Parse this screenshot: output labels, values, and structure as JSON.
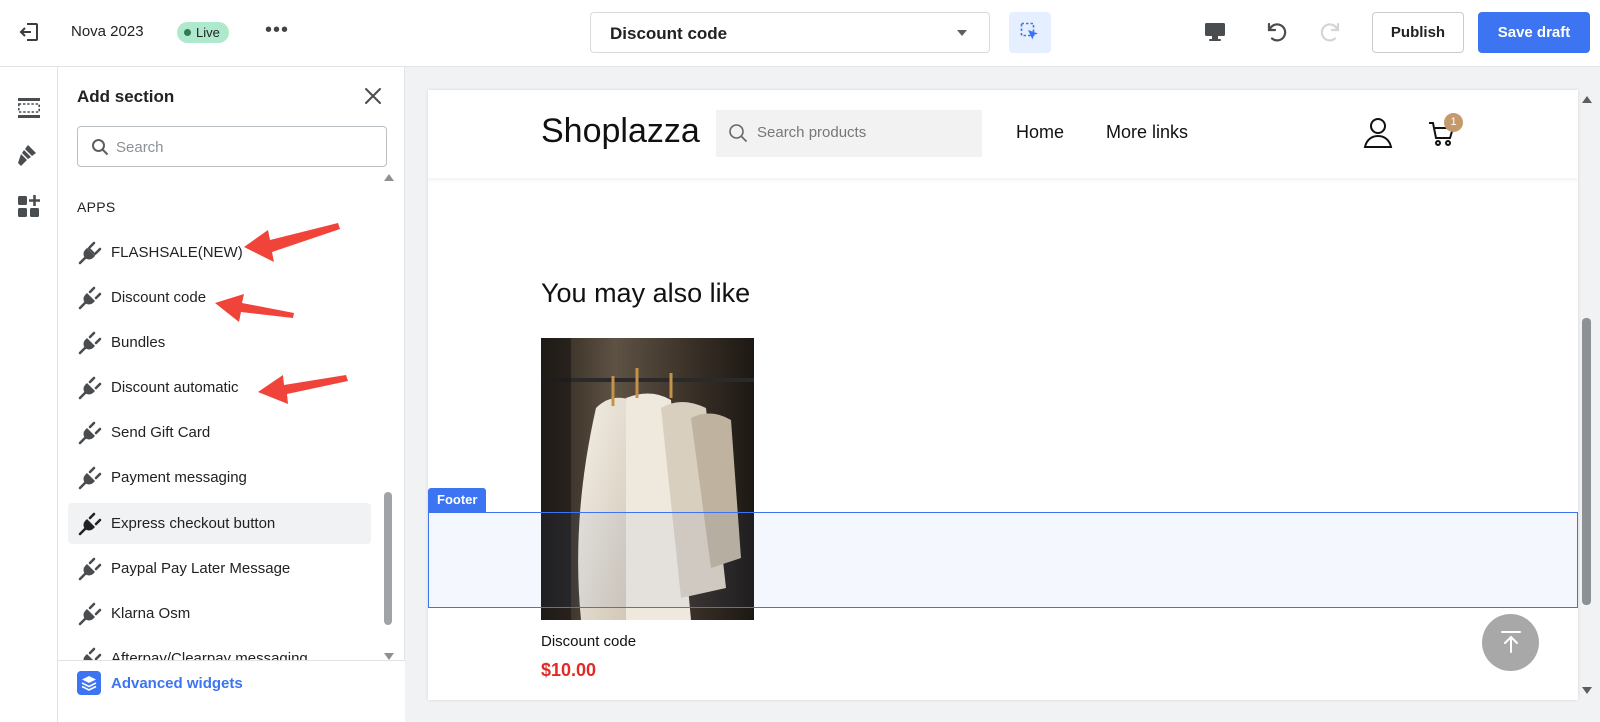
{
  "topbar": {
    "store_name": "Nova 2023",
    "status_badge": "Live",
    "more_label": "•••",
    "page_select_value": "Discount code",
    "publish_label": "Publish",
    "save_label": "Save draft",
    "accent_color": "#3c74f1"
  },
  "rail": {
    "items": [
      {
        "icon": "sections-icon"
      },
      {
        "icon": "theme-settings-brush-icon"
      },
      {
        "icon": "add-widget-icon"
      }
    ]
  },
  "panel": {
    "title": "Add section",
    "search_placeholder": "Search",
    "group_label": "APPS",
    "items": [
      {
        "label": "FLASHSALE(NEW)"
      },
      {
        "label": "Discount code"
      },
      {
        "label": "Bundles"
      },
      {
        "label": "Discount automatic"
      },
      {
        "label": "Send Gift Card"
      },
      {
        "label": "Payment messaging"
      },
      {
        "label": "Express checkout button"
      },
      {
        "label": "Paypal Pay Later Message"
      },
      {
        "label": "Klarna Osm"
      },
      {
        "label": "Afterpay/Clearpay messaging"
      }
    ],
    "footer_link": "Advanced widgets"
  },
  "preview": {
    "logo": "Shoplazza",
    "search_placeholder": "Search products",
    "nav": [
      "Home",
      "More links"
    ],
    "cart_count": "1",
    "section_heading": "You may also like",
    "product_name": "Discount code",
    "product_price": "$10.00",
    "footer_tag": "Footer",
    "price_color": "#e02b27"
  }
}
